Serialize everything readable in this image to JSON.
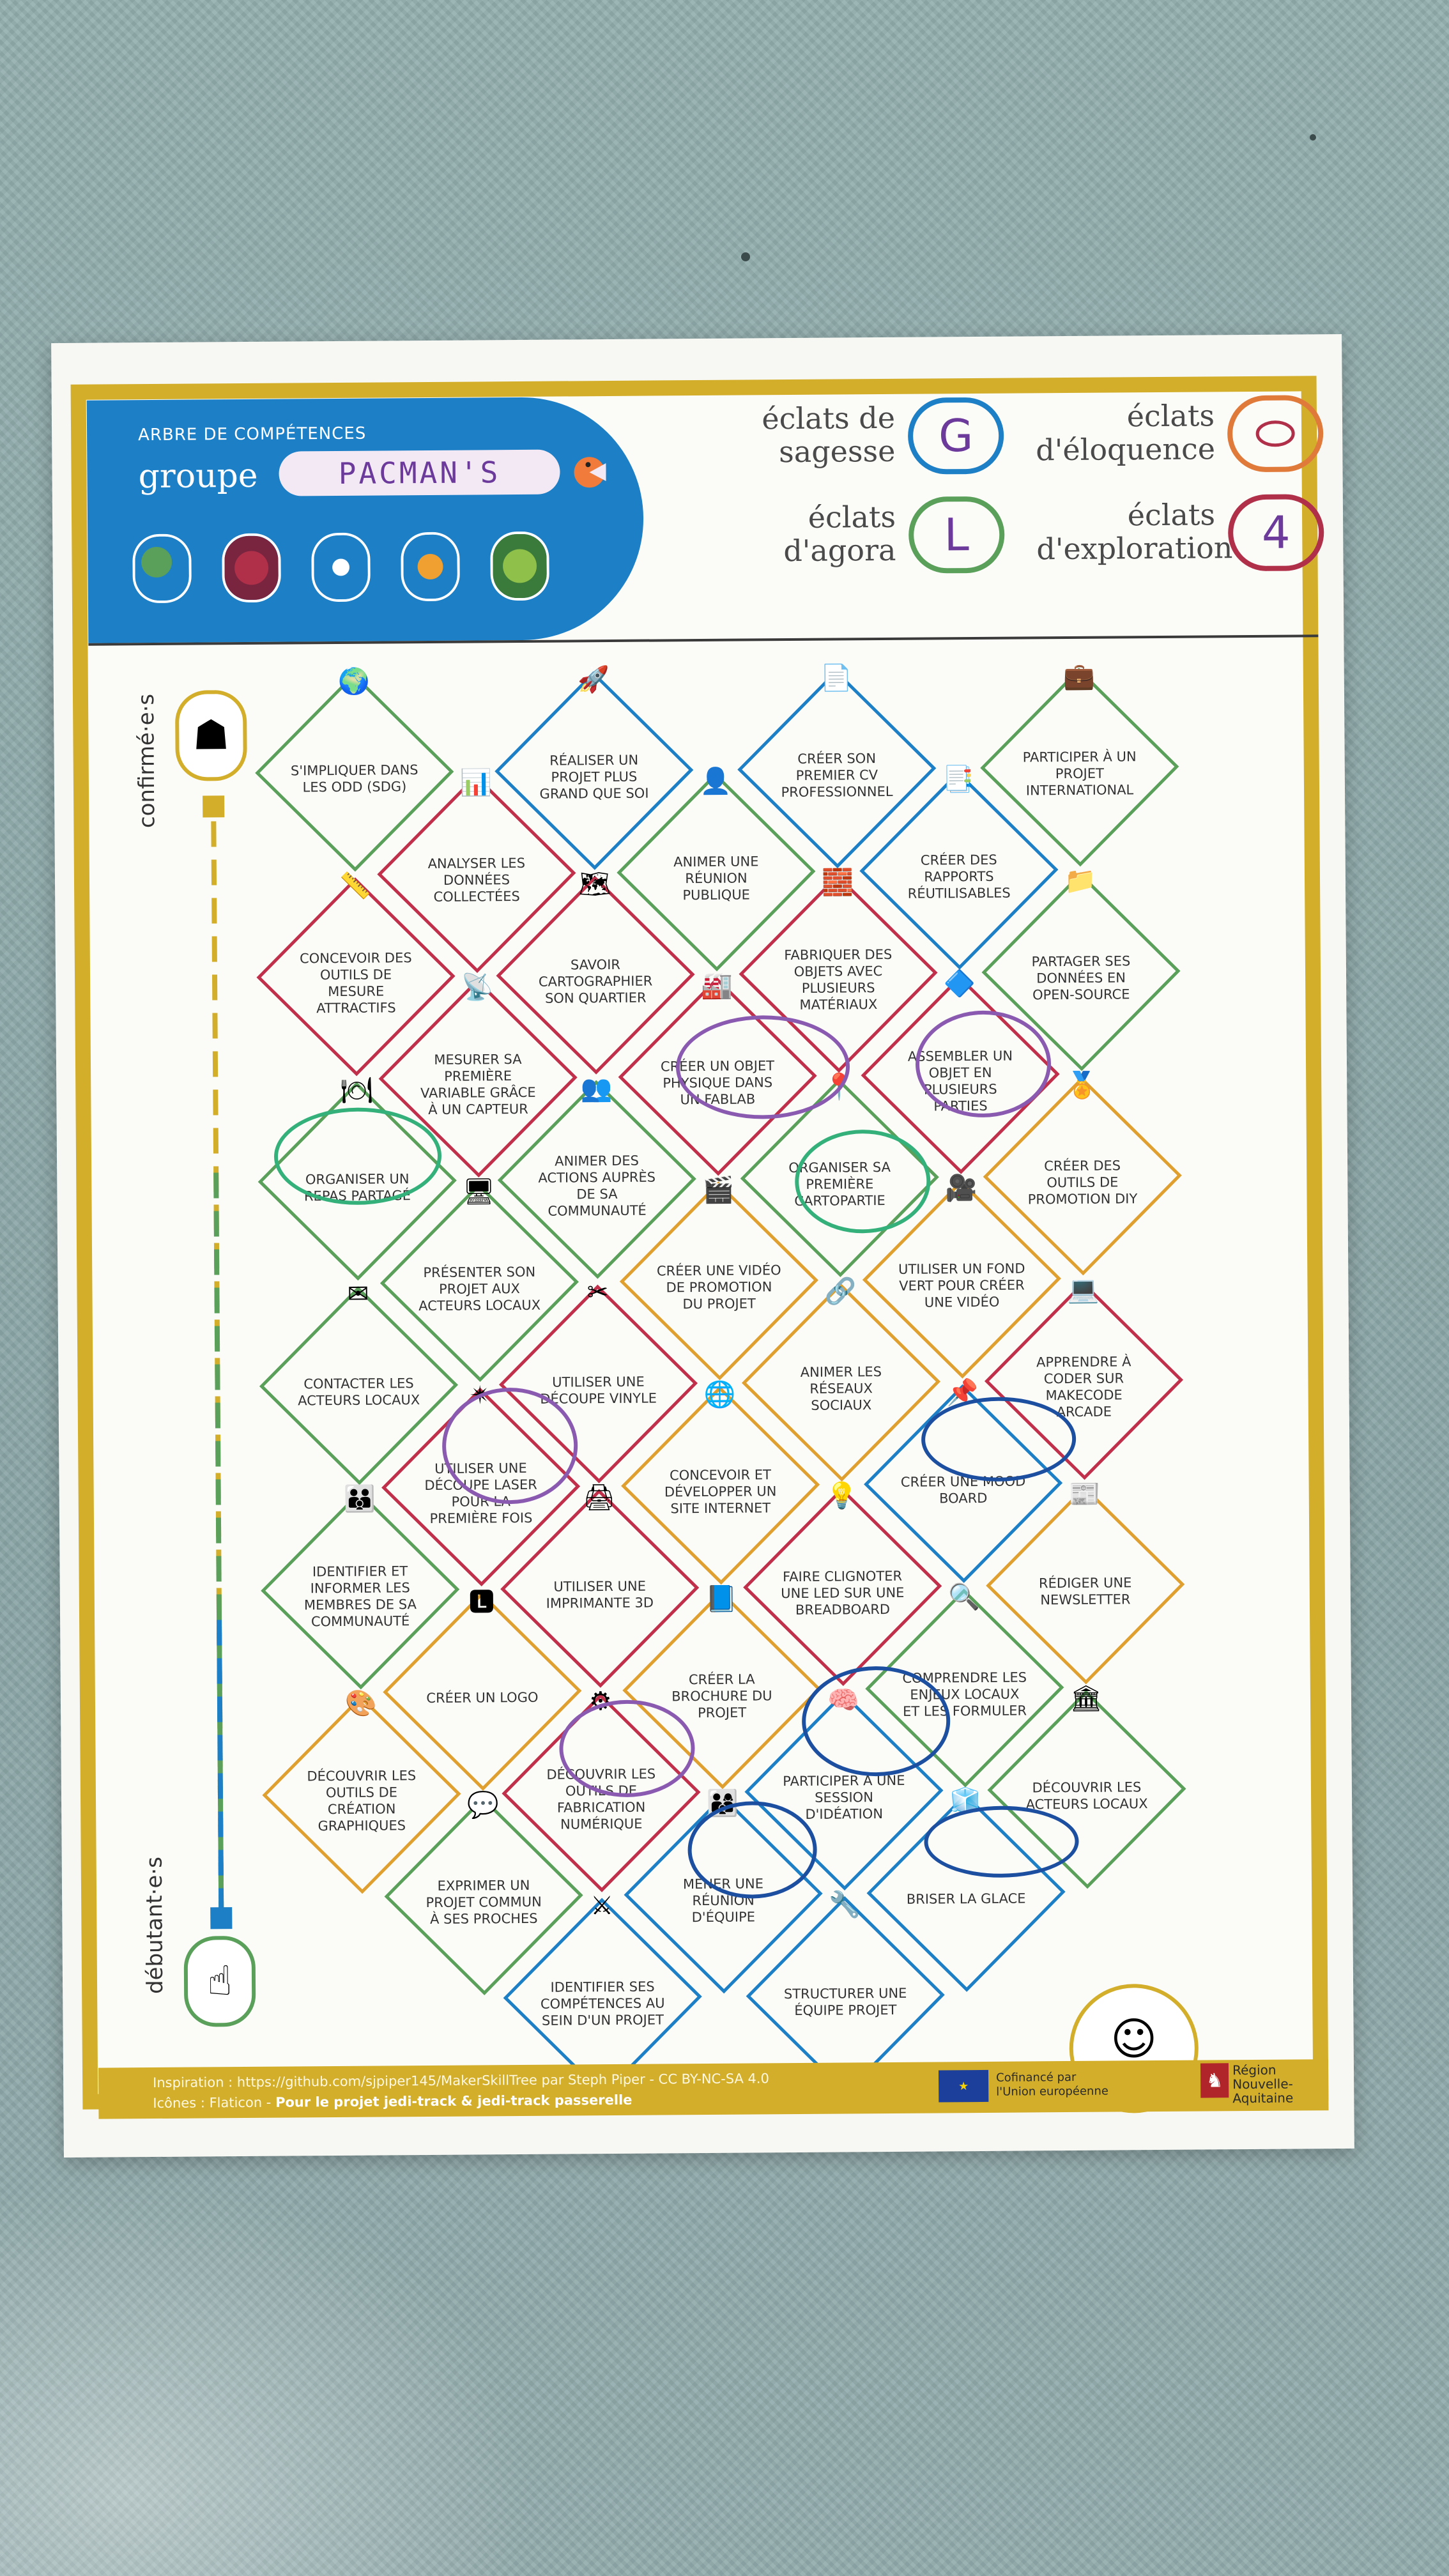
{
  "header": {
    "subtitle": "ARBRE DE COMPÉTENCES",
    "group_label": "groupe",
    "group_name": "PACMAN'S"
  },
  "legend": [
    {
      "label_1": "éclats de",
      "label_2": "sagesse",
      "letter": "G",
      "color": "#1d7fc5"
    },
    {
      "label_1": "éclats",
      "label_2": "d'éloquence",
      "letter": "",
      "color": "#e07a3a"
    },
    {
      "label_1": "éclats",
      "label_2": "d'agora",
      "letter": "L",
      "color": "#5aa05a"
    },
    {
      "label_1": "éclats",
      "label_2": "d'exploration",
      "letter": "4",
      "color": "#b0304a"
    }
  ],
  "side": {
    "top_label": "confirmé·e·s",
    "bottom_label": "débutant·e·s"
  },
  "skills": [
    {
      "text": "S'IMPLIQUER DANS LES ODD (SDG)",
      "color": "#5aa05a",
      "icon": "globe-heart-icon"
    },
    {
      "text": "RÉALISER UN PROJET PLUS GRAND QUE SOI",
      "color": "#1d7fc5",
      "icon": "rocket-icon"
    },
    {
      "text": "CRÉER SON PREMIER CV PROFESSIONNEL",
      "color": "#1d7fc5",
      "icon": "cv-icon"
    },
    {
      "text": "PARTICIPER À UN PROJET INTERNATIONAL",
      "color": "#5aa05a",
      "icon": "suitcase-icon"
    },
    {
      "text": "ANALYSER LES DONNÉES COLLECTÉES",
      "color": "#c0304a",
      "icon": "data-icon"
    },
    {
      "text": "ANIMER UNE RÉUNION PUBLIQUE",
      "color": "#5aa05a",
      "icon": "speaker-icon"
    },
    {
      "text": "CRÉER DES RAPPORTS RÉUTILISABLES",
      "color": "#1d7fc5",
      "icon": "report-icon"
    },
    {
      "text": "CONCEVOIR DES OUTILS DE MESURE ATTRACTIFS",
      "color": "#c0304a",
      "icon": "measure-icon"
    },
    {
      "text": "SAVOIR CARTOGRAPHIER SON QUARTIER",
      "color": "#c0304a",
      "icon": "map-icon"
    },
    {
      "text": "FABRIQUER DES OBJETS AVEC PLUSIEURS MATÉRIAUX",
      "color": "#c0304a",
      "icon": "materials-icon"
    },
    {
      "text": "PARTAGER SES DONNÉES EN OPEN-SOURCE",
      "color": "#5aa05a",
      "icon": "folder-icon"
    },
    {
      "text": "MESURER SA PREMIÈRE VARIABLE GRÂCE À UN CAPTEUR",
      "color": "#c0304a",
      "icon": "sensor-icon"
    },
    {
      "text": "CRÉER UN OBJET PHYSIQUE DANS UN FABLAB",
      "color": "#c0304a",
      "icon": "fablab-icon"
    },
    {
      "text": "ASSEMBLER UN OBJET EN PLUSIEURS PARTIES",
      "color": "#c0304a",
      "icon": "assembly-icon"
    },
    {
      "text": "ORGANISER UN REPAS PARTAGÉ",
      "color": "#5aa05a",
      "icon": "meal-icon"
    },
    {
      "text": "ANIMER DES ACTIONS AUPRÈS DE SA COMMUNAUTÉ",
      "color": "#5aa05a",
      "icon": "community-icon"
    },
    {
      "text": "ORGANISER SA PREMIÈRE CARTOPARTIE",
      "color": "#5aa05a",
      "icon": "map-pin-icon"
    },
    {
      "text": "CRÉER DES OUTILS DE PROMOTION DIY",
      "color": "#e0a030",
      "icon": "badge-icon"
    },
    {
      "text": "PRÉSENTER SON PROJET AUX ACTEURS LOCAUX",
      "color": "#5aa05a",
      "icon": "presentation-icon"
    },
    {
      "text": "CRÉER UNE VIDÉO DE PROMOTION DU PROJET",
      "color": "#e0a030",
      "icon": "video-icon"
    },
    {
      "text": "UTILISER UN FOND VERT POUR CRÉER UNE VIDÉO",
      "color": "#e0a030",
      "icon": "greenscreen-icon"
    },
    {
      "text": "CONTACTER LES ACTEURS LOCAUX",
      "color": "#5aa05a",
      "icon": "mail-icon"
    },
    {
      "text": "UTILISER UNE DÉCOUPE VINYLE",
      "color": "#c0304a",
      "icon": "vinyl-icon"
    },
    {
      "text": "ANIMER LES RÉSEAUX SOCIAUX",
      "color": "#e0a030",
      "icon": "network-icon"
    },
    {
      "text": "APPRENDRE À CODER SUR MAKECODE ARCADE",
      "color": "#c0304a",
      "icon": "code-icon"
    },
    {
      "text": "UTILISER UNE DÉCOUPE LASER POUR LA PREMIÈRE FOIS",
      "color": "#c0304a",
      "icon": "laser-icon"
    },
    {
      "text": "CONCEVOIR ET DÉVELOPPER UN SITE INTERNET",
      "color": "#e0a030",
      "icon": "web-icon"
    },
    {
      "text": "CRÉER UNE MOOD BOARD",
      "color": "#1d7fc5",
      "icon": "moodboard-icon"
    },
    {
      "text": "IDENTIFIER ET INFORMER LES MEMBRES DE SA COMMUNAUTÉ",
      "color": "#5aa05a",
      "icon": "members-icon"
    },
    {
      "text": "UTILISER UNE IMPRIMANTE 3D",
      "color": "#c0304a",
      "icon": "printer-3d-icon"
    },
    {
      "text": "FAIRE CLIGNOTER UNE LED SUR UNE BREADBOARD",
      "color": "#c0304a",
      "icon": "led-icon"
    },
    {
      "text": "RÉDIGER UNE NEWSLETTER",
      "color": "#e0a030",
      "icon": "newsletter-icon"
    },
    {
      "text": "CRÉER UN LOGO",
      "color": "#e0a030",
      "icon": "logo-icon"
    },
    {
      "text": "CRÉER LA BROCHURE DU PROJET",
      "color": "#e0a030",
      "icon": "brochure-icon"
    },
    {
      "text": "COMPRENDRE LES ENJEUX LOCAUX ET LES FORMULER",
      "color": "#5aa05a",
      "icon": "magnifier-icon"
    },
    {
      "text": "DÉCOUVRIR LES OUTILS DE CRÉATION GRAPHIQUES",
      "color": "#e0a030",
      "icon": "design-icon"
    },
    {
      "text": "DÉCOUVRIR LES OUTILS DE FABRICATION NUMÉRIQUE",
      "color": "#c0304a",
      "icon": "bulb-gear-icon"
    },
    {
      "text": "PARTICIPER À UNE SESSION D'IDÉATION",
      "color": "#1d7fc5",
      "icon": "ideation-icon"
    },
    {
      "text": "DÉCOUVRIR LES ACTEURS LOCAUX",
      "color": "#5aa05a",
      "icon": "actors-icon"
    },
    {
      "text": "EXPRIMER UN PROJET COMMUN À SES PROCHES",
      "color": "#5aa05a",
      "icon": "chat-icon"
    },
    {
      "text": "MENER UNE RÉUNION D'ÉQUIPE",
      "color": "#1d7fc5",
      "icon": "team-icon"
    },
    {
      "text": "BRISER LA GLACE",
      "color": "#1d7fc5",
      "icon": "ice-icon"
    },
    {
      "text": "IDENTIFIER SES COMPÉTENCES AU SEIN D'UN PROJET",
      "color": "#1d7fc5",
      "icon": "swords-icon"
    },
    {
      "text": "STRUCTURER UNE ÉQUIPE PROJET",
      "color": "#1d7fc5",
      "icon": "structure-icon"
    }
  ],
  "footer": {
    "line_1": "Inspiration : https://github.com/sjpiper145/MakerSkillTree par Steph Piper - CC BY-NC-SA 4.0",
    "line_2_a": "Icônes : Flaticon - ",
    "line_2_b": "Pour le projet jedi-track & jedi-track passerelle",
    "eu_text_1": "Cofinancé par",
    "eu_text_2": "l'Union européenne",
    "region_1": "Région",
    "region_2": "Nouvelle-",
    "region_3": "Aquitaine",
    "brand": "jedi-track"
  }
}
